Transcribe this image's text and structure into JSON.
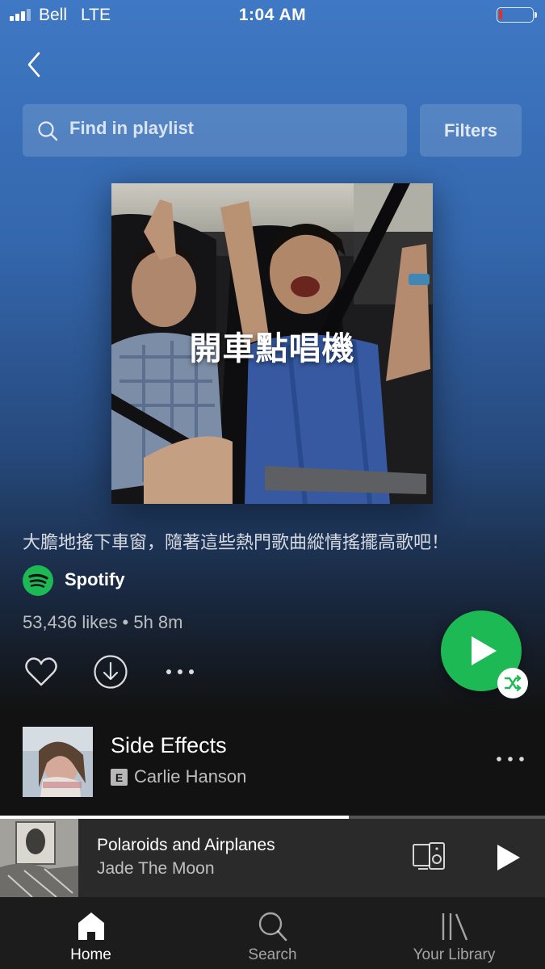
{
  "status_bar": {
    "carrier": "Bell",
    "network": "LTE",
    "time": "1:04 AM",
    "battery_color": "#e0302b"
  },
  "header": {
    "back_icon": "chevron-left-icon"
  },
  "search": {
    "placeholder": "Find in playlist",
    "filters_label": "Filters"
  },
  "playlist": {
    "cover_title": "開車點唱機",
    "description": "大膽地搖下車窗，隨著這些熱門歌曲縱情搖擺高歌吧！",
    "owner": "Spotify",
    "stats": "53,436 likes • 5h 8m"
  },
  "actions": {
    "heart": "heart-icon",
    "download": "download-icon",
    "more": "more-icon",
    "play": "play-icon",
    "shuffle": "shuffle-icon",
    "accent": "#1db954"
  },
  "tracks": [
    {
      "title": "Side Effects",
      "explicit": "E",
      "artist": "Carlie Hanson"
    }
  ],
  "now_playing": {
    "title": "Polaroids and Airplanes",
    "artist": "Jade The Moon",
    "progress": 0.64
  },
  "tabs": [
    {
      "label": "Home",
      "icon": "home-icon",
      "active": true
    },
    {
      "label": "Search",
      "icon": "search-icon",
      "active": false
    },
    {
      "label": "Your Library",
      "icon": "library-icon",
      "active": false
    }
  ]
}
